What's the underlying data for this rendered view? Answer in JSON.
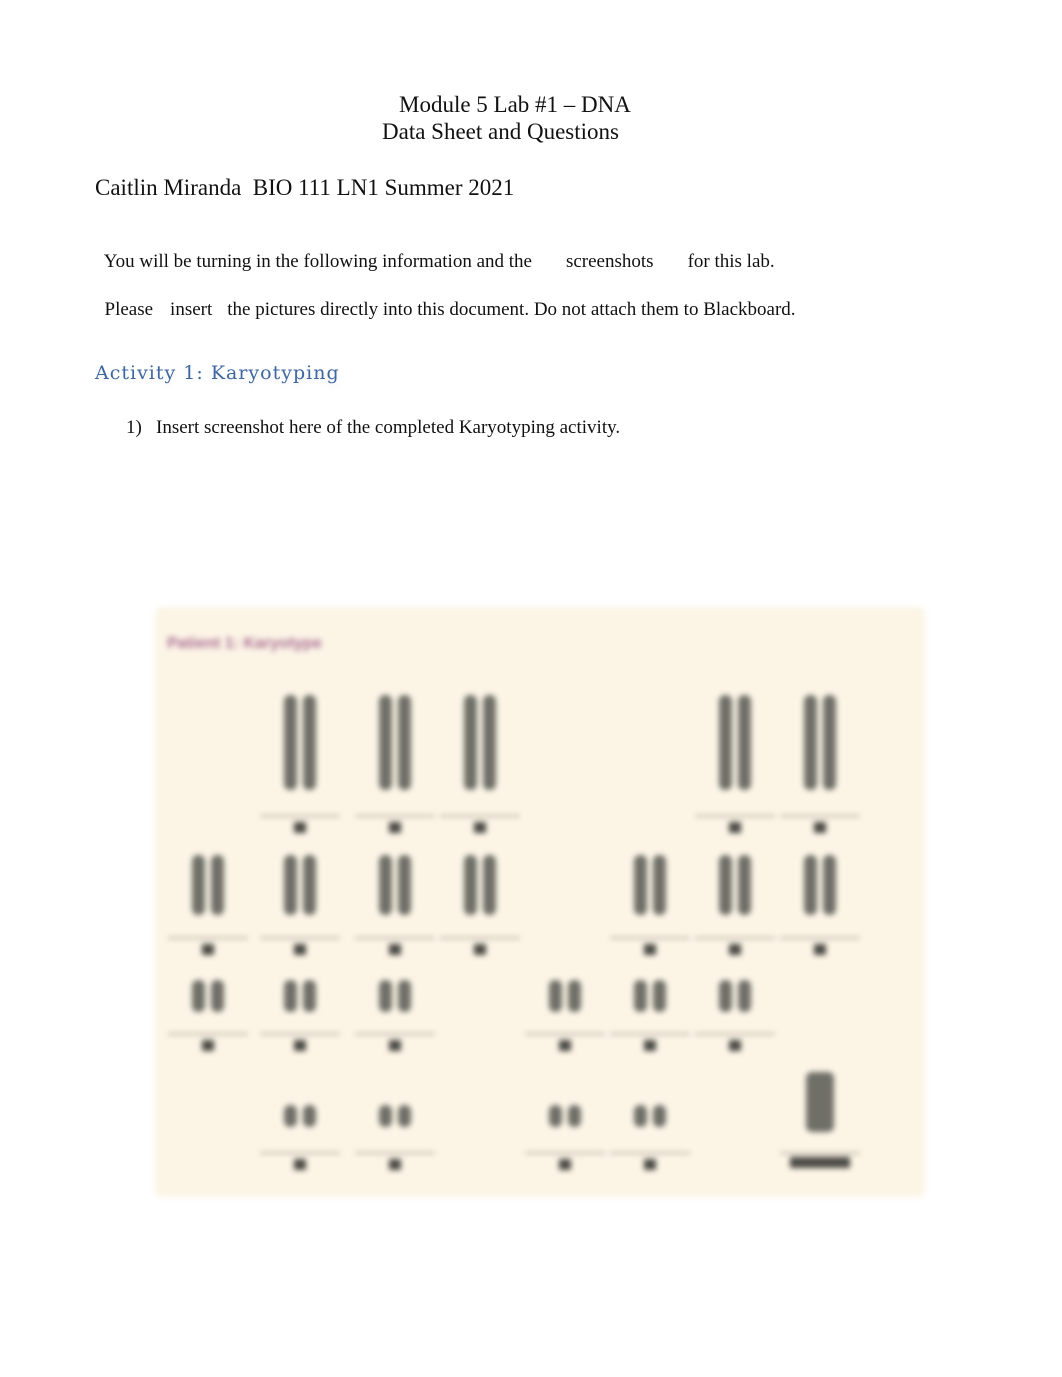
{
  "header": {
    "title_line1": "Module 5 Lab #1 – DNA",
    "title_line2": "Data Sheet and Questions"
  },
  "student_line": "Caitlin Miranda  BIO 111 LN1 Summer 2021",
  "instructions": {
    "line1_a": "You will be turning in the following information and the",
    "line1_b": "screenshots",
    "line1_c": "for this lab.",
    "line2_a": "Please",
    "line2_b": "insert",
    "line2_c": "the pictures directly into this document. Do not attach them to Blackboard."
  },
  "activity1": {
    "heading": "Activity 1: Karyotyping",
    "q1_number": "1)",
    "q1_text": "Insert screenshot here of the completed Karyotyping activity.",
    "screenshot": {
      "title": "Patient 1: Karyotype",
      "background_color": "#fcf5e6",
      "title_color": "#a86b92"
    }
  }
}
